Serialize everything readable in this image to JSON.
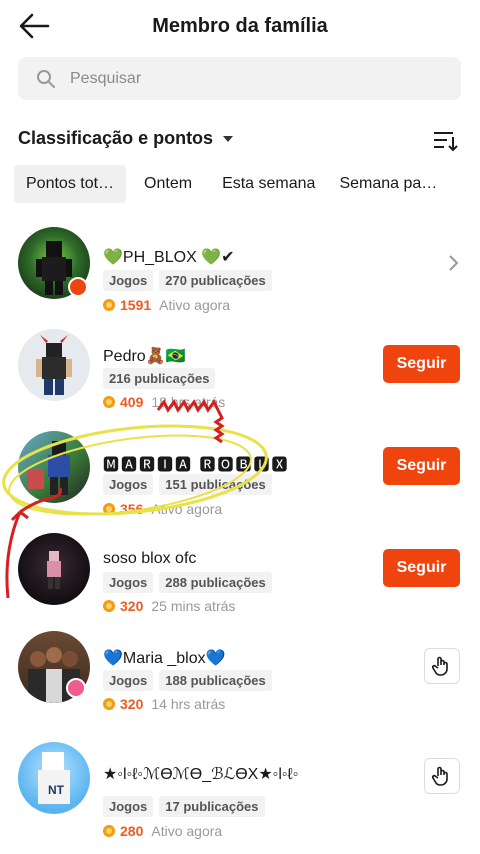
{
  "header": {
    "title": "Membro da família",
    "back_icon": "arrow-left-icon"
  },
  "search": {
    "placeholder": "Pesquisar",
    "value": ""
  },
  "sort": {
    "label": "Classificação e pontos",
    "icon": "sort-list-icon"
  },
  "tabs": [
    {
      "label": "Pontos tot…",
      "active": true
    },
    {
      "label": "Ontem",
      "active": false
    },
    {
      "label": "Esta semana",
      "active": false
    },
    {
      "label": "Semana pa…",
      "active": false
    }
  ],
  "members": [
    {
      "name": "💚PH_BLOX 💚✔",
      "tags": [
        "Jogos",
        "270 publicações"
      ],
      "points": "1591",
      "status": "Ativo agora",
      "action": "chevron",
      "badge": true
    },
    {
      "name": "Pedro🧸🇧🇷",
      "tags": [
        "216 publicações"
      ],
      "points": "409",
      "status": "18 hrs atrás",
      "action": "follow",
      "action_label": "Seguir",
      "badge": false
    },
    {
      "name": "🅼🅰🆁🅸🅰 🆁🅾🅱🅻🆇",
      "tags": [
        "Jogos",
        "151 publicações"
      ],
      "points": "356",
      "status": "Ativo agora",
      "action": "follow",
      "action_label": "Seguir",
      "badge": false
    },
    {
      "name": "soso blox ofc",
      "tags": [
        "Jogos",
        "288 publicações"
      ],
      "points": "320",
      "status": "25 mins atrás",
      "action": "follow",
      "action_label": "Seguir",
      "badge": false
    },
    {
      "name": "💙Maria _blox💙",
      "tags": [
        "Jogos",
        "188 publicações"
      ],
      "points": "320",
      "status": "14 hrs atrás",
      "action": "wave",
      "badge": true
    },
    {
      "name": "★◦l◦ℓ◦ℳϴℳϴ_ℬℒϴX★◦l◦ℓ◦",
      "tags": [
        "Jogos",
        "17 publicações"
      ],
      "points": "280",
      "status": "Ativo agora",
      "action": "wave",
      "badge": false
    }
  ],
  "colors": {
    "accent": "#f0440f",
    "points": "#f05a23",
    "tag_bg": "#f2f2f2"
  }
}
